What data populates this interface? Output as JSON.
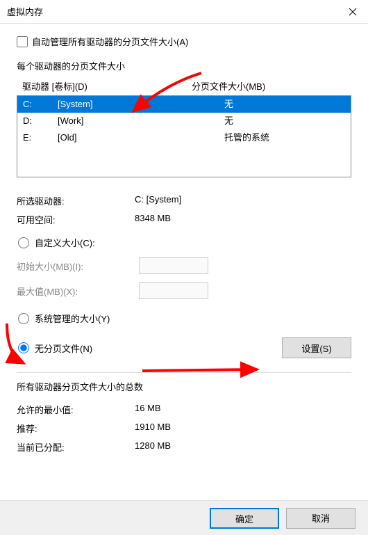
{
  "window": {
    "title": "虚拟内存"
  },
  "auto_manage": {
    "label": "自动管理所有驱动器的分页文件大小(A)"
  },
  "drives_section": {
    "title": "每个驱动器的分页文件大小",
    "col_drive": "驱动器 [卷标](D)",
    "col_size": "分页文件大小(MB)",
    "rows": [
      {
        "letter": "C:",
        "label": "[System]",
        "size": "无"
      },
      {
        "letter": "D:",
        "label": "[Work]",
        "size": "无"
      },
      {
        "letter": "E:",
        "label": "[Old]",
        "size": "托管的系统"
      }
    ]
  },
  "selected": {
    "drive_label": "所选驱动器:",
    "drive_value": "C:   [System]",
    "space_label": "可用空间:",
    "space_value": "8348 MB"
  },
  "options": {
    "custom": "自定义大小(C):",
    "initial": "初始大小(MB)(I):",
    "max": "最大值(MB)(X):",
    "system_managed": "系统管理的大小(Y)",
    "no_paging": "无分页文件(N)",
    "set_button": "设置(S)"
  },
  "totals": {
    "title": "所有驱动器分页文件大小的总数",
    "min_label": "允许的最小值:",
    "min_value": "16 MB",
    "rec_label": "推荐:",
    "rec_value": "1910 MB",
    "cur_label": "当前已分配:",
    "cur_value": "1280 MB"
  },
  "buttons": {
    "ok": "确定",
    "cancel": "取消"
  }
}
